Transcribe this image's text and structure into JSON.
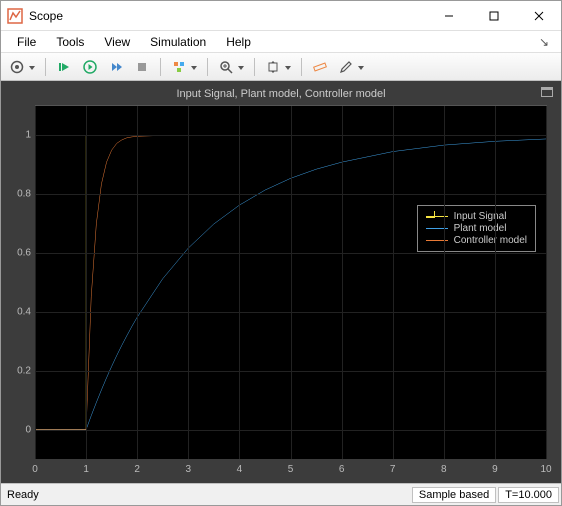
{
  "window": {
    "title": "Scope"
  },
  "menubar": {
    "items": [
      "File",
      "Tools",
      "View",
      "Simulation",
      "Help"
    ]
  },
  "toolbar": {
    "buttons": [
      {
        "name": "configure-gear",
        "caret": true
      },
      {
        "name": "restart"
      },
      {
        "name": "run"
      },
      {
        "name": "step-forward"
      },
      {
        "name": "stop"
      },
      {
        "name": "signals",
        "caret": true
      },
      {
        "name": "zoom",
        "caret": true
      },
      {
        "name": "autoscale",
        "caret": true
      },
      {
        "name": "measure"
      },
      {
        "name": "annotate",
        "caret": true
      }
    ]
  },
  "plot": {
    "title": "Input Signal, Plant model, Controller model",
    "legend": [
      {
        "label": "Input Signal",
        "color": "#f5e342"
      },
      {
        "label": "Plant model",
        "color": "#3fa0e6"
      },
      {
        "label": "Controller model",
        "color": "#e97a36"
      }
    ]
  },
  "status": {
    "left": "Ready",
    "mode": "Sample based",
    "time": "T=10.000"
  },
  "chart_data": {
    "type": "line",
    "title": "Input Signal, Plant model, Controller model",
    "xlabel": "",
    "ylabel": "",
    "xlim": [
      0,
      10
    ],
    "ylim": [
      -0.1,
      1.1
    ],
    "xticks": [
      0,
      1,
      2,
      3,
      4,
      5,
      6,
      7,
      8,
      9,
      10
    ],
    "yticks": [
      0,
      0.2,
      0.4,
      0.6,
      0.8,
      1
    ],
    "x": [
      0,
      0.5,
      1,
      1.1,
      1.2,
      1.3,
      1.4,
      1.5,
      1.6,
      1.7,
      1.8,
      1.9,
      2,
      2.5,
      3,
      3.5,
      4,
      4.5,
      5,
      5.5,
      6,
      7,
      8,
      9,
      10
    ],
    "series": [
      {
        "name": "Input Signal",
        "color": "#f5e342",
        "values": [
          0,
          0,
          0,
          1,
          1,
          1,
          1,
          1,
          1,
          1,
          1,
          1,
          1,
          1,
          1,
          1,
          1,
          1,
          1,
          1,
          1,
          1,
          1,
          1,
          1
        ]
      },
      {
        "name": "Plant model",
        "color": "#3fa0e6",
        "values": [
          0,
          0,
          0,
          0.047,
          0.092,
          0.135,
          0.176,
          0.215,
          0.252,
          0.287,
          0.32,
          0.352,
          0.382,
          0.513,
          0.617,
          0.699,
          0.763,
          0.814,
          0.854,
          0.885,
          0.909,
          0.945,
          0.967,
          0.98,
          0.988
        ]
      },
      {
        "name": "Controller model",
        "color": "#e97a36",
        "values": [
          0,
          0,
          0,
          0.451,
          0.699,
          0.835,
          0.909,
          0.95,
          0.973,
          0.985,
          0.992,
          0.995,
          0.997,
          1.0,
          1.0,
          1.0,
          1.0,
          1.0,
          1.0,
          1.0,
          1.0,
          1.0,
          1.0,
          1.0,
          1.0
        ]
      }
    ]
  }
}
